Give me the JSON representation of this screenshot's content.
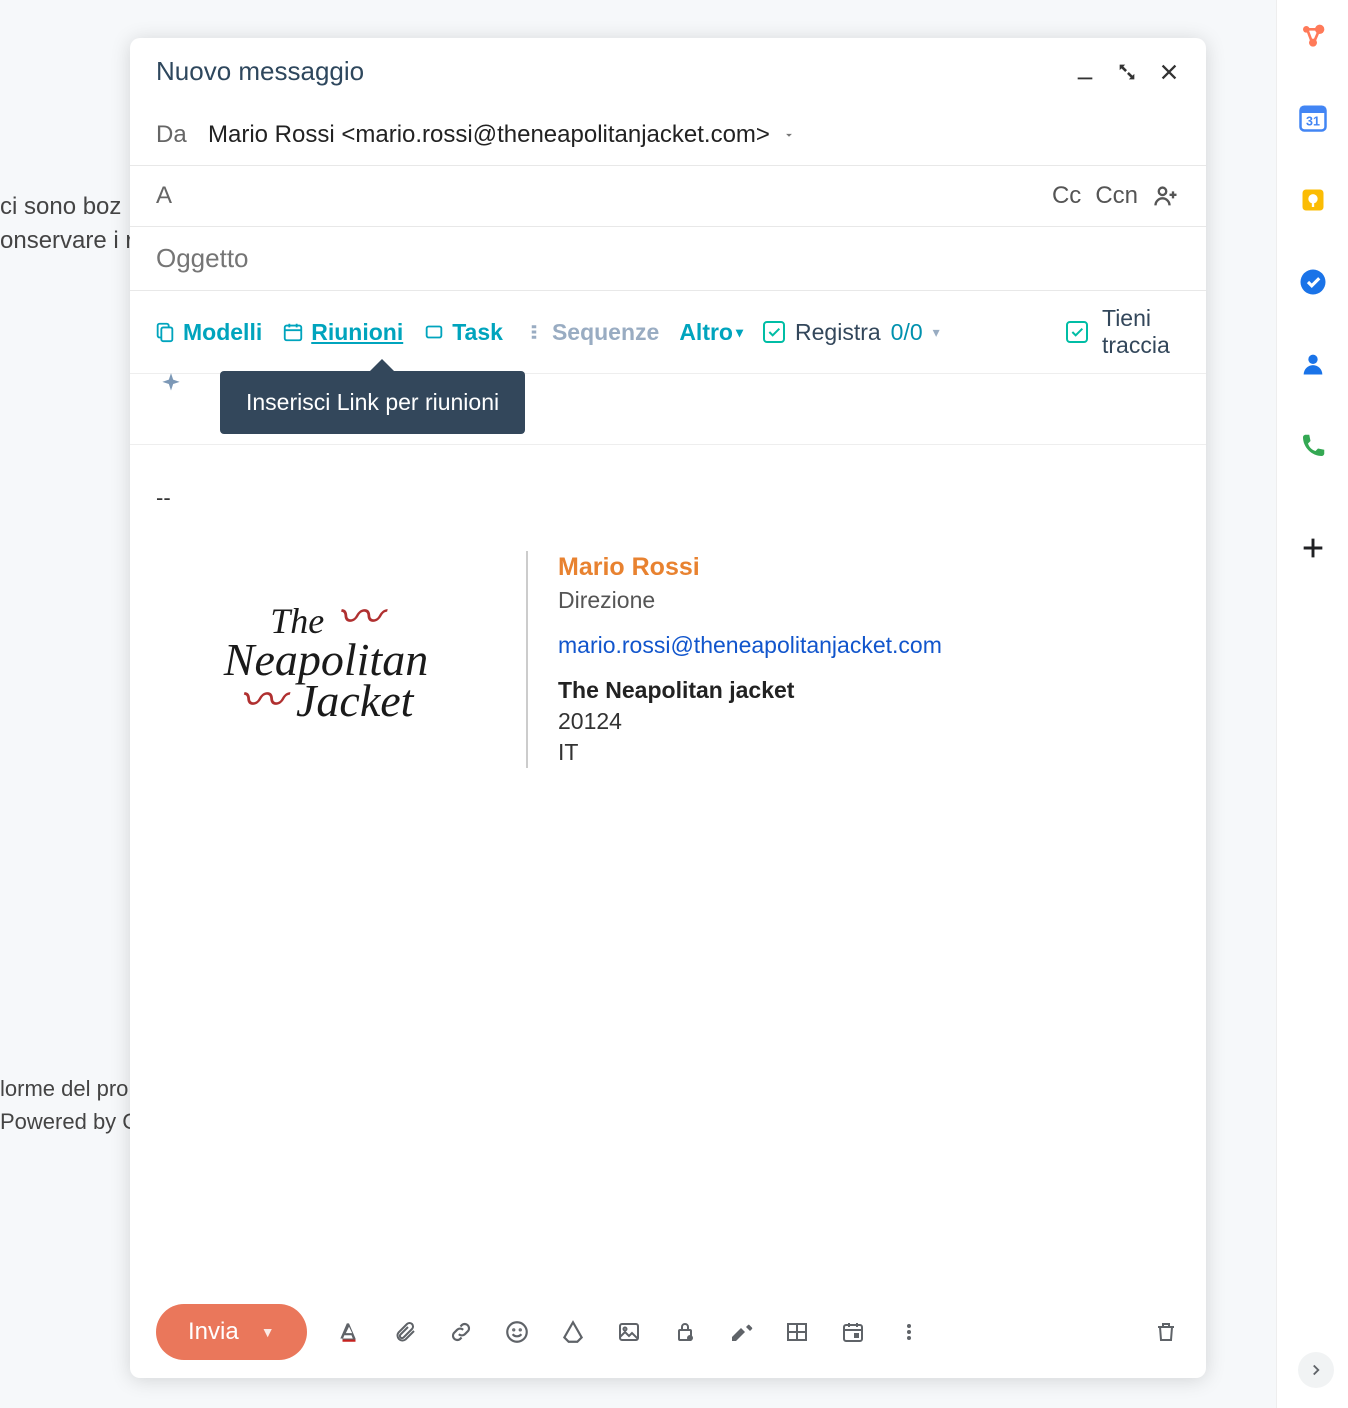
{
  "background": {
    "drafts_line1": "ci sono boz",
    "drafts_line2": "onservare i r",
    "bottom_line1": "lorme del pro",
    "bottom_line2": "Powered by C"
  },
  "header": {
    "title": "Nuovo messaggio"
  },
  "fields": {
    "from_label": "Da",
    "from_value": "Mario Rossi <mario.rossi@theneapolitanjacket.com>",
    "to_label": "A",
    "cc": "Cc",
    "ccn": "Ccn",
    "subject_placeholder": "Oggetto"
  },
  "hubspot": {
    "modelli": "Modelli",
    "riunioni": "Riunioni",
    "task": "Task",
    "sequenze": "Sequenze",
    "altro": "Altro",
    "registra": "Registra",
    "registra_count": "0/0",
    "track": "Tieni traccia",
    "tooltip": "Inserisci Link per riunioni"
  },
  "signature": {
    "sep": "--",
    "logo_line1": "The",
    "logo_line2": "Neapolitan",
    "logo_line3": "Jacket",
    "name": "Mario Rossi",
    "role": "Direzione",
    "email": "mario.rossi@theneapolitanjacket.com",
    "company": "The Neapolitan jacket",
    "postal": "20124",
    "country": "IT"
  },
  "footer": {
    "send": "Invia"
  },
  "sidepanel": {
    "calendar_day": "31"
  }
}
